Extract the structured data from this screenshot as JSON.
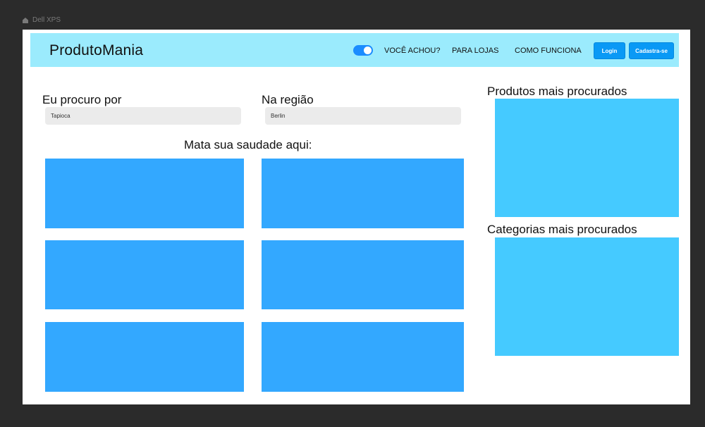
{
  "frame": {
    "device_label": "Dell XPS"
  },
  "navbar": {
    "brand": "ProdutoMania",
    "links": [
      "VOCÊ ACHOU?",
      "PARA LOJAS",
      "COMO FUNCIONA"
    ],
    "login_label": "Login",
    "signup_label": "Cadastra-se",
    "toggle_on": true
  },
  "search": {
    "query_label": "Eu procuro por",
    "query_value": "Tapioca",
    "region_label": "Na região",
    "region_value": "Berlin"
  },
  "main": {
    "title": "Mata sua saudade aqui:",
    "tile_count": 6
  },
  "sidebar": {
    "products_title": "Produtos mais procurados",
    "categories_title": "Categorias mais procurados"
  },
  "colors": {
    "background": "#2b2b2b",
    "navbar": "#9bebfd",
    "accent": "#0a99f5",
    "tile": "#33a8ff",
    "side_panel": "#45caff",
    "input_bg": "#ebebeb"
  }
}
